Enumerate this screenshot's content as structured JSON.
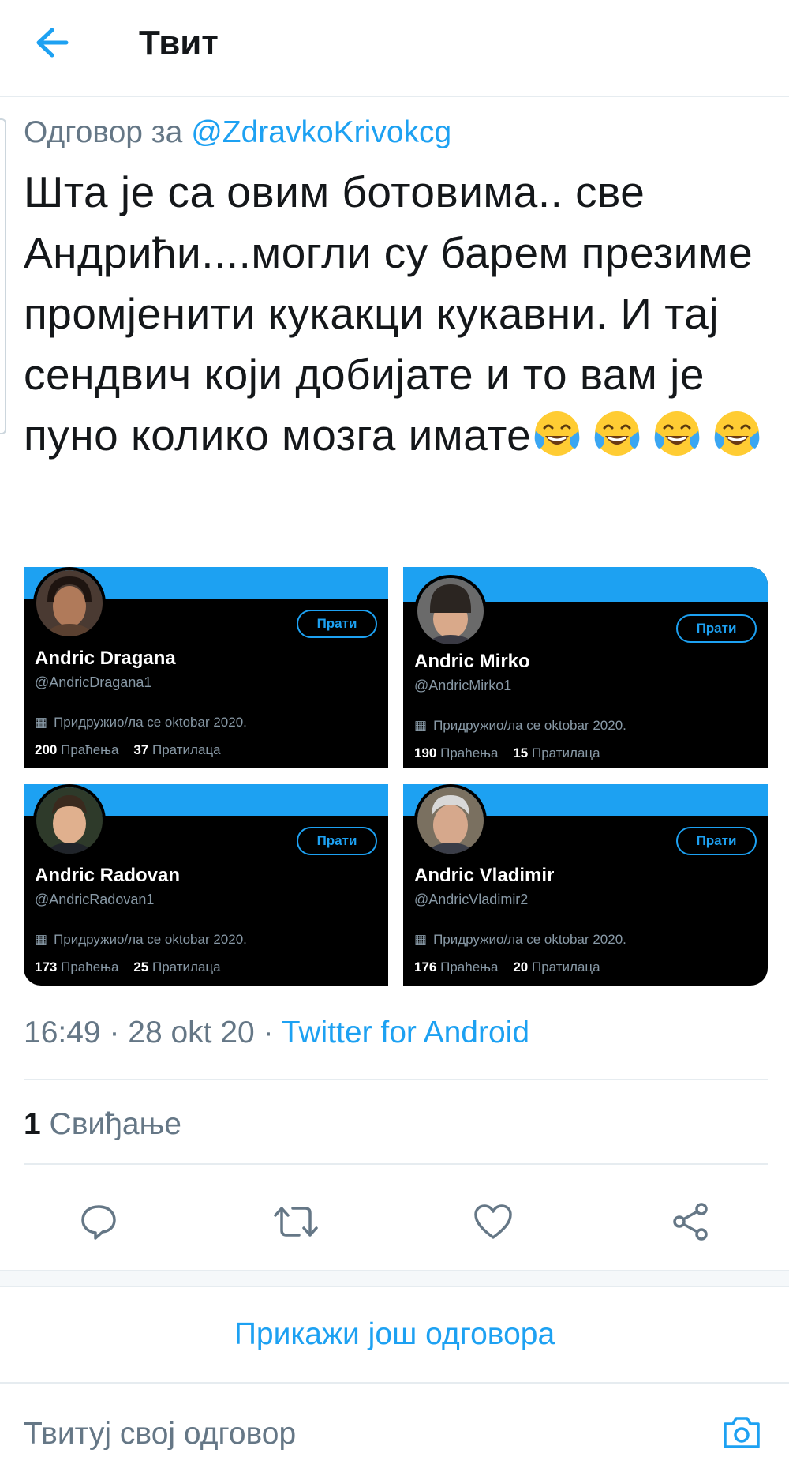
{
  "header": {
    "title": "Твит"
  },
  "tweet": {
    "reply_prefix": "Одговор за ",
    "reply_handle": "@ZdravkoKrivokcg",
    "text": "Шта је са овим ботовима.. све Андрићи....могли су барем презиме промјенити кукакци кукавни. И тај сендвич који добијате и то вам је пуно колико мозга имате",
    "emoji": [
      "face-with-tears-of-joy",
      "face-with-tears-of-joy",
      "face-with-tears-of-joy",
      "face-with-tears-of-joy"
    ]
  },
  "cards": [
    {
      "name": "Andric Dragana",
      "handle": "@AndricDragana1",
      "joined": "Придружио/ла се oktobar 2020.",
      "following": "200",
      "following_label": "Праћења",
      "followers": "37",
      "followers_label": "Пратилаца",
      "follow_label": "Прати"
    },
    {
      "name": "Andric Mirko",
      "handle": "@AndricMirko1",
      "joined": "Придружио/ла се oktobar 2020.",
      "following": "190",
      "following_label": "Праћења",
      "followers": "15",
      "followers_label": "Пратилаца",
      "follow_label": "Прати"
    },
    {
      "name": "Andric Radovan",
      "handle": "@AndricRadovan1",
      "joined": "Придружио/ла се oktobar 2020.",
      "following": "173",
      "following_label": "Праћења",
      "followers": "25",
      "followers_label": "Пратилаца",
      "follow_label": "Прати"
    },
    {
      "name": "Andric Vladimir",
      "handle": "@AndricVladimir2",
      "joined": "Придружио/ла се oktobar 2020.",
      "following": "176",
      "following_label": "Праћења",
      "followers": "20",
      "followers_label": "Пратилаца",
      "follow_label": "Прати"
    }
  ],
  "meta": {
    "time": "16:49",
    "date": "28 okt 20",
    "source": "Twitter for Android"
  },
  "likes": {
    "count": "1",
    "label": "Свиђање"
  },
  "actions": [
    "reply-icon",
    "retweet-icon",
    "like-icon",
    "share-icon"
  ],
  "show_more": "Прикажи још одговора",
  "reply_box": {
    "placeholder": "Твитуј свој одговор"
  },
  "colors": {
    "accent": "#1da1f2",
    "text": "#14171a",
    "muted": "#657786",
    "divider": "#e6ecf0",
    "card_bg": "#000000"
  }
}
